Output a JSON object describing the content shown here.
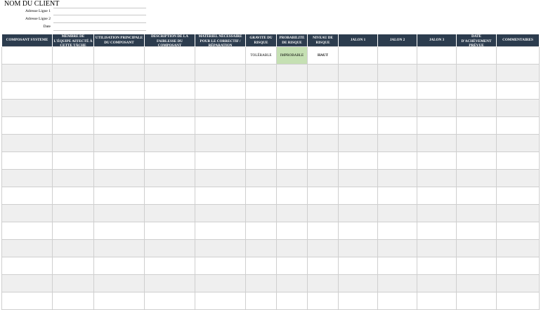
{
  "client": {
    "name": "NOM DU CLIENT",
    "fields": [
      {
        "label": "Adresse Ligne 1",
        "value": ""
      },
      {
        "label": "Adresse Ligne 2",
        "value": ""
      },
      {
        "label": "Date",
        "value": ""
      }
    ]
  },
  "table": {
    "headers": [
      "COMPOSANT SYSTÈME",
      "MEMBRE DE L'ÉQUIPE AFFECTÉ À CETTE TÂCHE",
      "UTILISATION PRINCIPALE DU COMPOSANT",
      "DESCRIPTION DE LA FAIBLESSE DU COMPOSANT",
      "MATÉRIEL NÉCESSAIRE POUR LE CORRECTIF / RÉPARATION",
      "GRAVITÉ DU RISQUE",
      "PROBABILITÉ DE RISQUE",
      "NIVEAU DE RISQUE",
      "JALON 1",
      "JALON 2",
      "JALON 3",
      "DATE D'ACHÈVEMENT PRÉVUE",
      "COMMENTAIRES"
    ],
    "rows": [
      [
        "",
        "",
        "",
        "",
        "",
        "TOLÉRABLE",
        "IMPROBABLE",
        "HAUT",
        "",
        "",
        "",
        "",
        ""
      ],
      [
        "",
        "",
        "",
        "",
        "",
        "",
        "",
        "",
        "",
        "",
        "",
        "",
        ""
      ],
      [
        "",
        "",
        "",
        "",
        "",
        "",
        "",
        "",
        "",
        "",
        "",
        "",
        ""
      ],
      [
        "",
        "",
        "",
        "",
        "",
        "",
        "",
        "",
        "",
        "",
        "",
        "",
        ""
      ],
      [
        "",
        "",
        "",
        "",
        "",
        "",
        "",
        "",
        "",
        "",
        "",
        "",
        ""
      ],
      [
        "",
        "",
        "",
        "",
        "",
        "",
        "",
        "",
        "",
        "",
        "",
        "",
        ""
      ],
      [
        "",
        "",
        "",
        "",
        "",
        "",
        "",
        "",
        "",
        "",
        "",
        "",
        ""
      ],
      [
        "",
        "",
        "",
        "",
        "",
        "",
        "",
        "",
        "",
        "",
        "",
        "",
        ""
      ],
      [
        "",
        "",
        "",
        "",
        "",
        "",
        "",
        "",
        "",
        "",
        "",
        "",
        ""
      ],
      [
        "",
        "",
        "",
        "",
        "",
        "",
        "",
        "",
        "",
        "",
        "",
        "",
        ""
      ],
      [
        "",
        "",
        "",
        "",
        "",
        "",
        "",
        "",
        "",
        "",
        "",
        "",
        ""
      ],
      [
        "",
        "",
        "",
        "",
        "",
        "",
        "",
        "",
        "",
        "",
        "",
        "",
        ""
      ],
      [
        "",
        "",
        "",
        "",
        "",
        "",
        "",
        "",
        "",
        "",
        "",
        "",
        ""
      ],
      [
        "",
        "",
        "",
        "",
        "",
        "",
        "",
        "",
        "",
        "",
        "",
        "",
        ""
      ],
      [
        "",
        "",
        "",
        "",
        "",
        "",
        "",
        "",
        "",
        "",
        "",
        "",
        ""
      ]
    ]
  },
  "colors": {
    "header_bg": "#2c3c4e",
    "probability_highlight": "#c5e0b3",
    "alt_row": "#efefef"
  }
}
